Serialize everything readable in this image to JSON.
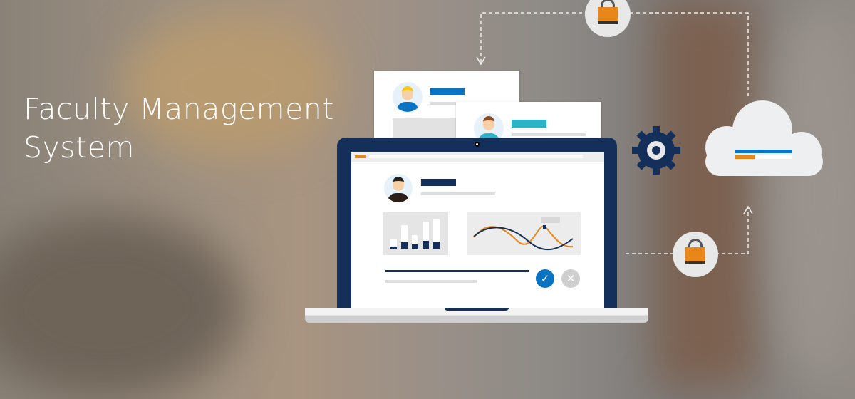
{
  "banner": {
    "title_line1": "Faculty Management",
    "title_line2": "System"
  },
  "colors": {
    "navy": "#14305a",
    "blue": "#0a74c2",
    "orange": "#e8861a",
    "teal": "#2cb3c8",
    "gray": "#d4d4d4"
  },
  "icons": [
    "lock-icon",
    "gear-icon",
    "cloud-icon",
    "check-icon",
    "close-icon",
    "user-avatar"
  ]
}
